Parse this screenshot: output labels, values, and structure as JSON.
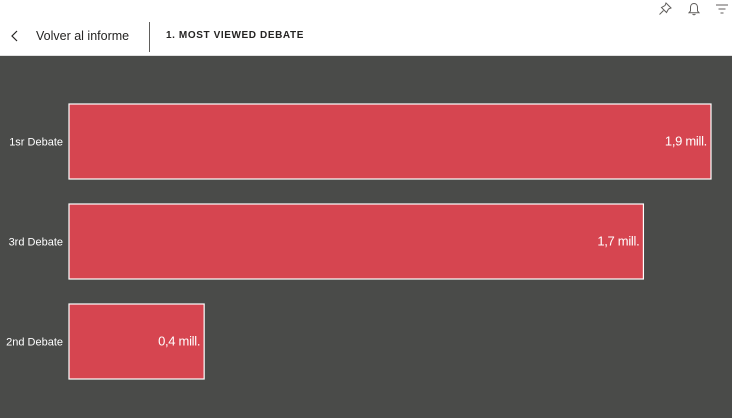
{
  "header": {
    "back_label": "Volver al informe",
    "page_title": "1. MOST VIEWED DEBATE"
  },
  "icons": {
    "back": "chevron-left-icon",
    "pin": "pin-icon",
    "notifications": "bell-icon",
    "filter": "filter-icon"
  },
  "colors": {
    "bar": "#d64550",
    "plot_background": "#4a4b49",
    "text_on_plot": "#ffffff"
  },
  "chart_data": {
    "type": "bar",
    "orientation": "horizontal",
    "categories": [
      "1sr Debate",
      "3rd Debate",
      "2nd Debate"
    ],
    "values": [
      1.9,
      1.7,
      0.4
    ],
    "value_labels": [
      "1,9 mill.",
      "1,7 mill.",
      "0,4 mill."
    ],
    "xlim": [
      0,
      1.9
    ],
    "grid": false,
    "title": "",
    "xlabel": "",
    "ylabel": ""
  }
}
